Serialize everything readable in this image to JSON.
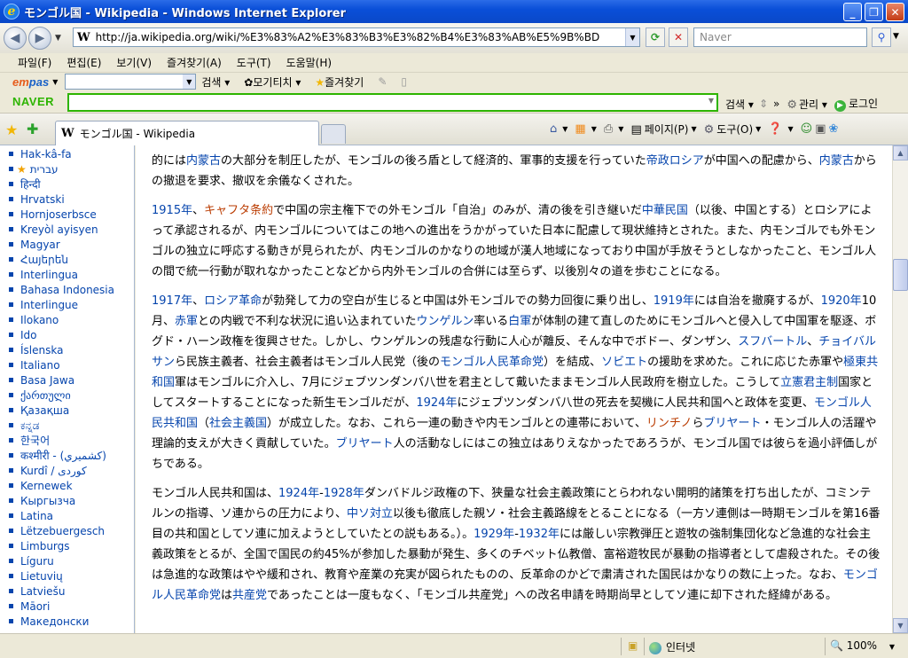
{
  "window": {
    "title": "モンゴル国 - Wikipedia - Windows Internet Explorer",
    "min": "_",
    "max": "❐",
    "close": "✕"
  },
  "address": {
    "url": "http://ja.wikipedia.org/wiki/%E3%83%A2%E3%83%B3%E3%82%B4%E3%83%AB%E5%9B%BD",
    "search_placeholder": "Naver"
  },
  "menu": [
    "파일(F)",
    "편집(E)",
    "보기(V)",
    "즐겨찾기(A)",
    "도구(T)",
    "도움말(H)"
  ],
  "empas": {
    "logo_a": "em",
    "logo_b": "pas",
    "search": "검색",
    "mogi": "모기티치",
    "fav": "즐겨찾기"
  },
  "naver": {
    "logo": "NAVER",
    "search": "검색",
    "manage": "관리",
    "login": "로그인"
  },
  "tab": {
    "title": "モンゴル国 - Wikipedia"
  },
  "cmd": {
    "page": "페이지(P)",
    "tools": "도구(O)"
  },
  "languages": [
    {
      "name": "Hak-kâ-fa"
    },
    {
      "name": "עברית",
      "star": true
    },
    {
      "name": "हिन्दी"
    },
    {
      "name": "Hrvatski"
    },
    {
      "name": "Hornjoserbsce"
    },
    {
      "name": "Kreyòl ayisyen"
    },
    {
      "name": "Magyar"
    },
    {
      "name": "Հայերեն"
    },
    {
      "name": "Interlingua"
    },
    {
      "name": "Bahasa Indonesia"
    },
    {
      "name": "Interlingue"
    },
    {
      "name": "Ilokano"
    },
    {
      "name": "Ido"
    },
    {
      "name": "Íslenska"
    },
    {
      "name": "Italiano"
    },
    {
      "name": "Basa Jawa"
    },
    {
      "name": "ქართული"
    },
    {
      "name": "Қазақша"
    },
    {
      "name": "ಕನ್ನಡ"
    },
    {
      "name": "한국어"
    },
    {
      "name": "कश्मीरी - (كشميري)"
    },
    {
      "name": "Kurdî / كوردی"
    },
    {
      "name": "Kernewek"
    },
    {
      "name": "Кыргызча"
    },
    {
      "name": "Latina"
    },
    {
      "name": "Lëtzebuergesch"
    },
    {
      "name": "Limburgs"
    },
    {
      "name": "Líguru"
    },
    {
      "name": "Lietuvių"
    },
    {
      "name": "Latviešu"
    },
    {
      "name": "Māori"
    },
    {
      "name": "Македонски"
    }
  ],
  "paragraphs": [
    [
      {
        "t": "的には"
      },
      {
        "t": "内蒙古",
        "l": 1
      },
      {
        "t": "の大部分を制圧したが、モンゴルの後ろ盾として経済的、軍事的支援を行っていた"
      },
      {
        "t": "帝政ロシア",
        "l": 1
      },
      {
        "t": "が中国への配慮から、"
      },
      {
        "t": "内蒙古",
        "l": 1
      },
      {
        "t": "からの撤退を要求、撤収を余儀なくされた。"
      }
    ],
    [
      {
        "t": "1915年",
        "l": 1
      },
      {
        "t": "、"
      },
      {
        "t": "キャフタ条約",
        "l": 2
      },
      {
        "t": "で中国の宗主権下での外モンゴル「自治」のみが、清の後を引き継いだ"
      },
      {
        "t": "中華民国",
        "l": 1
      },
      {
        "t": "（以後、中国とする）とロシアによって承認されるが、内モンゴルについてはこの地への進出をうかがっていた日本に配慮して現状維持とされた。また、内モンゴルでも外モンゴルの独立に呼応する動きが見られたが、内モンゴルのかなりの地域が漢人地域になっており中国が手放そうとしなかったこと、モンゴル人の間で統一行動が取れなかったことなどから内外モンゴルの合併には至らず、以後別々の道を歩むことになる。"
      }
    ],
    [
      {
        "t": "1917年",
        "l": 1
      },
      {
        "t": "、"
      },
      {
        "t": "ロシア革命",
        "l": 1
      },
      {
        "t": "が勃発して力の空白が生じると中国は外モンゴルでの勢力回復に乗り出し、"
      },
      {
        "t": "1919年",
        "l": 1
      },
      {
        "t": "には自治を撤廃するが、"
      },
      {
        "t": "1920年",
        "l": 1
      },
      {
        "t": "10月、"
      },
      {
        "t": "赤軍",
        "l": 1
      },
      {
        "t": "との内戦で不利な状況に追い込まれていた"
      },
      {
        "t": "ウンゲルン",
        "l": 1
      },
      {
        "t": "率いる"
      },
      {
        "t": "白軍",
        "l": 1
      },
      {
        "t": "が体制の建て直しのためにモンゴルへと侵入して中国軍を駆逐、ボグド・ハーン政権を復興させた。しかし、ウンゲルンの残虐な行動に人心が離反、そんな中でボドー、ダンザン、"
      },
      {
        "t": "スフバートル",
        "l": 1
      },
      {
        "t": "、"
      },
      {
        "t": "チョイバルサン",
        "l": 1
      },
      {
        "t": "ら民族主義者、社会主義者はモンゴル人民党（後の"
      },
      {
        "t": "モンゴル人民革命党",
        "l": 1
      },
      {
        "t": "）を結成、"
      },
      {
        "t": "ソビエト",
        "l": 1
      },
      {
        "t": "の援助を求めた。これに応じた赤軍や"
      },
      {
        "t": "極東共和国",
        "l": 1
      },
      {
        "t": "軍はモンゴルに介入し、7月にジェブツンダンバ八世を君主として戴いたままモンゴル人民政府を樹立した。こうして"
      },
      {
        "t": "立憲君主制",
        "l": 1
      },
      {
        "t": "国家としてスタートすることになった新生モンゴルだが、"
      },
      {
        "t": "1924年",
        "l": 1
      },
      {
        "t": "にジェブツンダンバ八世の死去を契機に人民共和国へと政体を変更、"
      },
      {
        "t": "モンゴル人民共和国",
        "l": 1
      },
      {
        "t": "（"
      },
      {
        "t": "社会主義国",
        "l": 1
      },
      {
        "t": "）が成立した。なお、これら一連の動きや内モンゴルとの連帯において、"
      },
      {
        "t": "リンチノ",
        "l": 2
      },
      {
        "t": "ら"
      },
      {
        "t": "ブリヤート",
        "l": 1
      },
      {
        "t": "・モンゴル人の活躍や理論的支えが大きく貢献していた。"
      },
      {
        "t": "ブリヤート",
        "l": 1
      },
      {
        "t": "人の活動なしにはこの独立はありえなかったであろうが、モンゴル国では彼らを過小評価しがちである。"
      }
    ],
    [
      {
        "t": "モンゴル人民共和国は、"
      },
      {
        "t": "1924年",
        "l": 1
      },
      {
        "t": "-"
      },
      {
        "t": "1928年",
        "l": 1
      },
      {
        "t": "ダンバドルジ政権の下、狭量な社会主義政策にとらわれない開明的諸策を打ち出したが、コミンテルンの指導、ソ連からの圧力により、"
      },
      {
        "t": "中ソ対立",
        "l": 1
      },
      {
        "t": "以後も徹底した親ソ・社会主義路線をとることになる（一方ソ連側は一時期モンゴルを第16番目の共和国としてソ連に加えようとしていたとの説もある。）。"
      },
      {
        "t": "1929年",
        "l": 1
      },
      {
        "t": "-"
      },
      {
        "t": "1932年",
        "l": 1
      },
      {
        "t": "には厳しい宗教弾圧と遊牧の強制集団化など急進的な社会主義政策をとるが、全国で国民の約45%が参加した暴動が発生、多くのチベット仏教僧、富裕遊牧民が暴動の指導者として虐殺された。その後は急進的な政策はやや緩和され、教育や産業の充実が図られたものの、反革命のかどで粛清された国民はかなりの数に上った。なお、"
      },
      {
        "t": "モンゴル人民革命党",
        "l": 1
      },
      {
        "t": "は"
      },
      {
        "t": "共産党",
        "l": 1
      },
      {
        "t": "であったことは一度もなく、「モンゴル共産党」への改名申請を時期尚早としてソ連に却下された経緯がある。"
      }
    ]
  ],
  "status": {
    "zone": "인터넷",
    "zoom": "100%"
  }
}
